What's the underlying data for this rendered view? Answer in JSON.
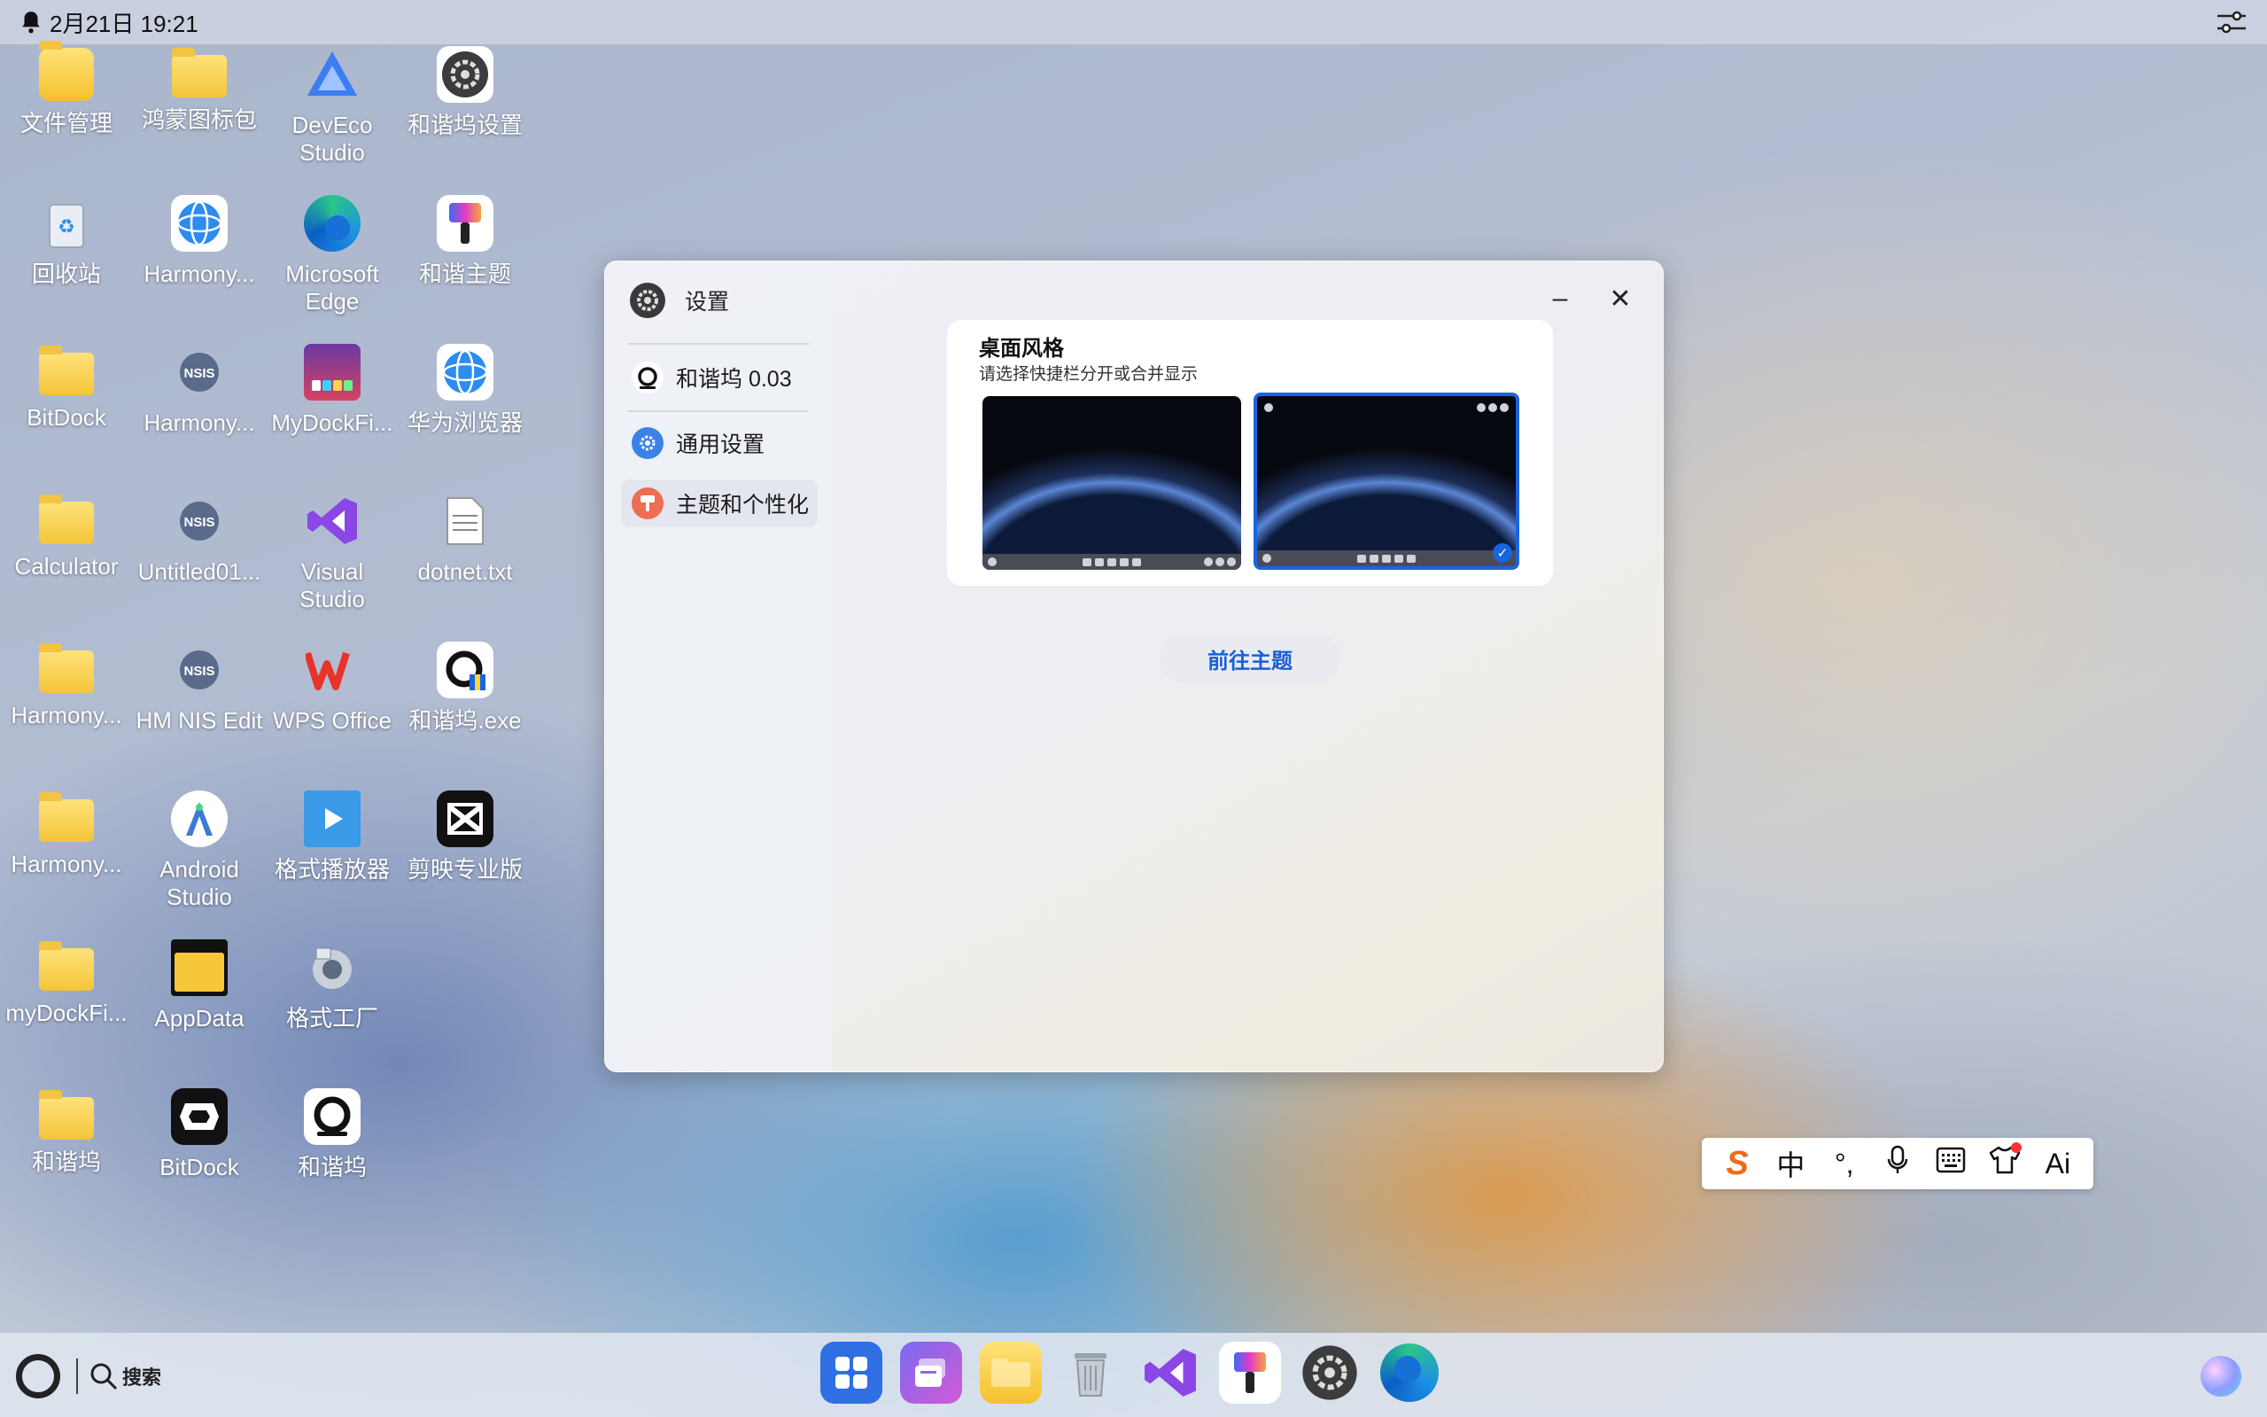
{
  "statusbar": {
    "datetime": "2月21日 19:21",
    "bell_icon": "bell-icon",
    "controls_icon": "sliders-icon"
  },
  "desktop": {
    "icons": [
      {
        "label": "文件管理",
        "icon": "file-manager-icon"
      },
      {
        "label": "鸿蒙图标包",
        "icon": "icon-pack-icon"
      },
      {
        "label": "DevEco Studio",
        "icon": "deveco-icon"
      },
      {
        "label": "和谐坞设置",
        "icon": "settings-gear-icon"
      },
      {
        "label": "回收站",
        "icon": "recycle-bin-icon"
      },
      {
        "label": "Harmony...",
        "icon": "harmony-browser-icon"
      },
      {
        "label": "Microsoft Edge",
        "icon": "edge-icon"
      },
      {
        "label": "和谐主题",
        "icon": "theme-brush-icon"
      },
      {
        "label": "BitDock",
        "icon": "folder-icon"
      },
      {
        "label": "Harmony...",
        "icon": "nsis-icon"
      },
      {
        "label": "MyDockFi...",
        "icon": "mydock-icon"
      },
      {
        "label": "华为浏览器",
        "icon": "huawei-browser-icon"
      },
      {
        "label": "Calculator",
        "icon": "folder-icon"
      },
      {
        "label": "Untitled01...",
        "icon": "nsis-icon"
      },
      {
        "label": "Visual Studio",
        "icon": "visual-studio-icon"
      },
      {
        "label": "dotnet.txt",
        "icon": "text-file-icon"
      },
      {
        "label": "Harmony...",
        "icon": "folder-icon"
      },
      {
        "label": "HM NIS Edit",
        "icon": "nsis-icon"
      },
      {
        "label": "WPS Office",
        "icon": "wps-icon"
      },
      {
        "label": "和谐坞.exe",
        "icon": "hexiewu-exe-icon"
      },
      {
        "label": "Harmony...",
        "icon": "folder-icon"
      },
      {
        "label": "Android Studio",
        "icon": "android-studio-icon"
      },
      {
        "label": "格式播放器",
        "icon": "video-player-icon"
      },
      {
        "label": "剪映专业版",
        "icon": "capcut-icon"
      },
      {
        "label": "myDockFi...",
        "icon": "folder-icon"
      },
      {
        "label": "AppData",
        "icon": "folder-icon"
      },
      {
        "label": "格式工厂",
        "icon": "format-factory-icon"
      },
      {
        "label": "和谐坞",
        "icon": "folder-icon"
      },
      {
        "label": "BitDock",
        "icon": "bitdock-icon"
      },
      {
        "label": "和谐坞",
        "icon": "hexiewu-icon"
      }
    ]
  },
  "window": {
    "title": "设置",
    "sidebar": {
      "items": [
        {
          "label": "和谐坞 0.03",
          "icon": "hexiewu-icon"
        },
        {
          "label": "通用设置",
          "icon": "gear-icon"
        },
        {
          "label": "主题和个性化",
          "icon": "brush-icon"
        }
      ],
      "active_index": 2
    },
    "minimize_label": "–",
    "close_label": "✕",
    "card": {
      "title": "桌面风格",
      "subtitle": "请选择快捷栏分开或合并显示",
      "selected_option": 2
    },
    "go_theme_button": "前往主题"
  },
  "ime_toolbar": {
    "logo": "S",
    "mode": "中",
    "punct": "°,",
    "icons": [
      "microphone-icon",
      "keyboard-icon",
      "skin-shirt-icon"
    ],
    "ai": "Ai"
  },
  "taskbar": {
    "search_label": "搜索",
    "dock": [
      {
        "icon": "app-grid-icon"
      },
      {
        "icon": "multitask-icon"
      },
      {
        "icon": "folder-icon"
      },
      {
        "icon": "trash-icon"
      },
      {
        "icon": "visual-studio-icon"
      },
      {
        "icon": "theme-brush-icon"
      },
      {
        "icon": "settings-gear-icon"
      },
      {
        "icon": "edge-icon"
      }
    ],
    "assistant_icon": "assistant-orb-icon"
  },
  "colors": {
    "accent": "#1a64e0",
    "button_text": "#1a5fd8",
    "folder": "#f4c53a"
  }
}
